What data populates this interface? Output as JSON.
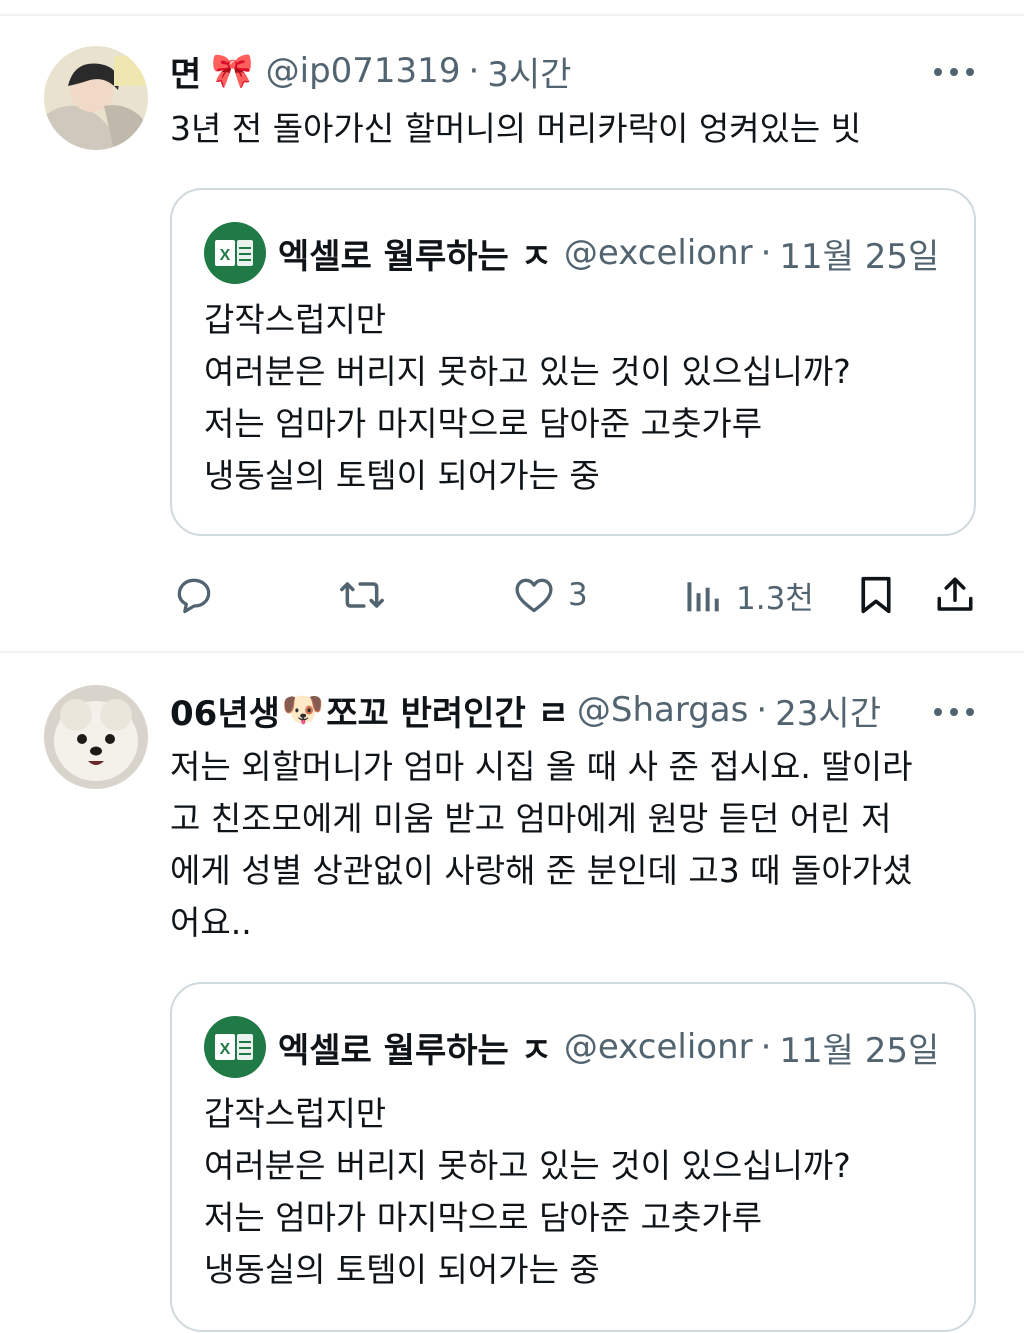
{
  "posts": [
    {
      "name": "면",
      "name_emoji": "🎀",
      "handle": "@ip071319",
      "time": "3시간",
      "text_lines": [
        "3년 전 돌아가신 할머니의 머리카락이 엉켜있는 빗"
      ],
      "quote": {
        "name": "엑셀로 월루하는 ㅈ",
        "handle": "@excelionr",
        "time": "11월 25일",
        "text_lines": [
          "갑작스럽지만",
          "여러분은 버리지 못하고 있는 것이 있으십니까?",
          "저는 엄마가 마지막으로 담아준 고춧가루",
          "냉동실의 토템이 되어가는 중"
        ]
      },
      "actions": {
        "likes": "3",
        "views": "1.3천"
      }
    },
    {
      "name": "06년생",
      "name_emoji": "🐶",
      "name_suffix": "쪼꼬 반려인간 ㄹ",
      "handle": "@Shargas",
      "time": "23시간",
      "text_lines": [
        "저는 외할머니가 엄마 시집 올 때 사 준 접시요. 딸이라",
        "고 친조모에게 미움 받고 엄마에게 원망 듣던 어린 저",
        "에게 성별 상관없이 사랑해 준 분인데 고3 때 돌아가셨",
        "어요.."
      ],
      "quote": {
        "name": "엑셀로 월루하는 ㅈ",
        "handle": "@excelionr",
        "time": "11월 25일",
        "text_lines": [
          "갑작스럽지만",
          "여러분은 버리지 못하고 있는 것이 있으십니까?",
          "저는 엄마가 마지막으로 담아준 고춧가루",
          "냉동실의 토템이 되어가는 중"
        ]
      }
    }
  ],
  "icons": {
    "more": "more-dots-icon",
    "reply": "reply-icon",
    "repost": "repost-icon",
    "like": "heart-icon",
    "views": "views-chart-icon",
    "bookmark": "bookmark-icon",
    "share": "share-icon",
    "quote_logo": "excel-logo-icon"
  },
  "colors": {
    "text": "#0f1419",
    "secondary": "#536471",
    "border": "#cfd9de",
    "excel_green": "#1f7a45",
    "divider": "#eff3f4"
  }
}
